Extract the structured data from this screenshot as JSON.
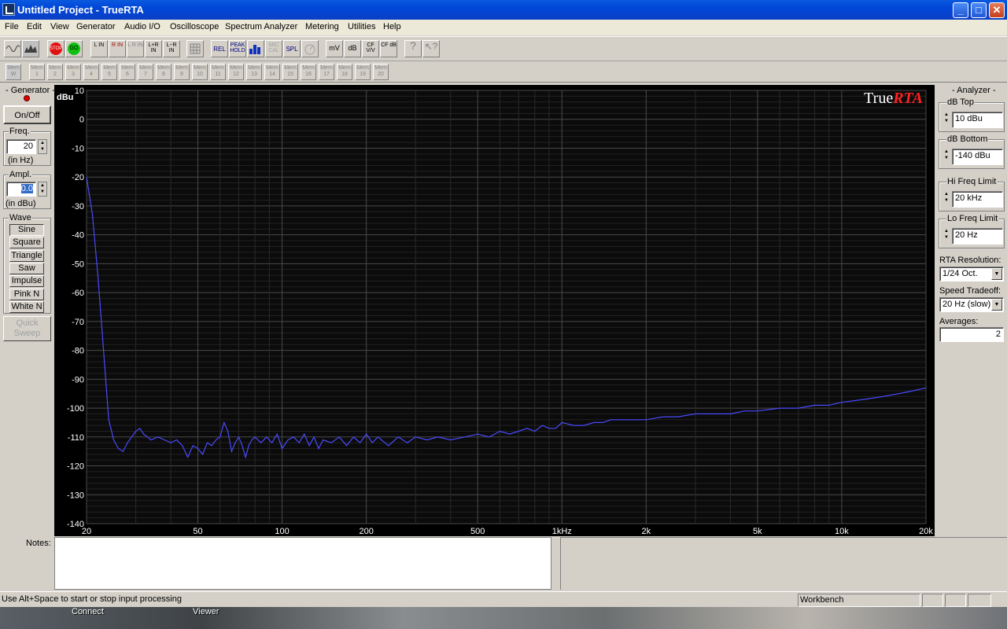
{
  "window": {
    "title": "Untitled Project - TrueRTA"
  },
  "menu": [
    "File",
    "Edit",
    "View",
    "Generator",
    "Audio I/O",
    "Oscilloscope",
    "Spectrum Analyzer",
    "Metering",
    "Utilities",
    "Help"
  ],
  "toolbar": {
    "stop": "STOP",
    "go": "GO",
    "l_in": "L IN",
    "r_in": "R IN",
    "lr_in": "L R IN",
    "lplusr_in": "L+R IN",
    "lminusr_in": "L−R IN",
    "rel": "REL",
    "peak_hold": "PEAK HOLD",
    "mic_cal": "MIC CAL",
    "spl": "SPL",
    "mv": "mV",
    "db": "dB",
    "cf_vv": "CF V/V",
    "cf_db": "CF dB"
  },
  "memory": {
    "write_label": "Mem W",
    "slot_label": "Mem",
    "slots": [
      "1",
      "2",
      "3",
      "4",
      "5",
      "6",
      "7",
      "8",
      "9",
      "10",
      "11",
      "12",
      "13",
      "14",
      "15",
      "16",
      "17",
      "18",
      "19",
      "20"
    ]
  },
  "generator": {
    "title": "- Generator -",
    "onoff": "On/Off",
    "freq_title": "Freq.",
    "freq_value": "20",
    "freq_unit": "(in Hz)",
    "ampl_title": "Ampl.",
    "ampl_value": "0.0",
    "ampl_unit": "(in dBu)",
    "wave_title": "Wave",
    "waves": [
      "Sine",
      "Square",
      "Triangle",
      "Saw",
      "Impulse",
      "Pink N",
      "White N"
    ],
    "quick_sweep": [
      "Quick",
      "Sweep"
    ]
  },
  "analyzer": {
    "title": "- Analyzer -",
    "db_top_label": "dB Top",
    "db_top_value": "10 dBu",
    "db_bottom_label": "dB Bottom",
    "db_bottom_value": "-140 dBu",
    "hi_freq_label": "Hi Freq Limit",
    "hi_freq_value": "20 kHz",
    "lo_freq_label": "Lo Freq Limit",
    "lo_freq_value": "20 Hz",
    "rta_res_label": "RTA Resolution:",
    "rta_res_value": "1/24 Oct.",
    "speed_label": "Speed Tradeoff:",
    "speed_value": "20 Hz (slow)",
    "averages_label": "Averages:",
    "averages_value": "2"
  },
  "chart_data": {
    "type": "line",
    "logo_true": "True",
    "logo_rta": "RTA",
    "ylabel": "dBu",
    "xscale": "log",
    "xlim": [
      20,
      20000
    ],
    "ylim": [
      -140,
      10
    ],
    "yticks": [
      10,
      0,
      -10,
      -20,
      -30,
      -40,
      -50,
      -60,
      -70,
      -80,
      -90,
      -100,
      -110,
      -120,
      -130,
      -140
    ],
    "xticks": [
      {
        "v": 20,
        "label": "20"
      },
      {
        "v": 50,
        "label": "50"
      },
      {
        "v": 100,
        "label": "100"
      },
      {
        "v": 200,
        "label": "200"
      },
      {
        "v": 500,
        "label": "500"
      },
      {
        "v": 1000,
        "label": "1kHz"
      },
      {
        "v": 2000,
        "label": "2k"
      },
      {
        "v": 5000,
        "label": "5k"
      },
      {
        "v": 10000,
        "label": "10k"
      },
      {
        "v": 20000,
        "label": "20k"
      }
    ],
    "line_color": "#4a4aff",
    "grid": true,
    "series": [
      {
        "points": [
          [
            20,
            -20
          ],
          [
            21,
            -33
          ],
          [
            22,
            -55
          ],
          [
            23,
            -80
          ],
          [
            24,
            -104
          ],
          [
            25,
            -111
          ],
          [
            26,
            -114
          ],
          [
            27,
            -115
          ],
          [
            28,
            -112
          ],
          [
            29,
            -110
          ],
          [
            30,
            -108
          ],
          [
            31,
            -107
          ],
          [
            32,
            -109
          ],
          [
            33,
            -110
          ],
          [
            34,
            -111
          ],
          [
            36,
            -110
          ],
          [
            38,
            -111
          ],
          [
            40,
            -112
          ],
          [
            42,
            -111
          ],
          [
            44,
            -113
          ],
          [
            46,
            -117
          ],
          [
            48,
            -113
          ],
          [
            50,
            -114
          ],
          [
            52,
            -116
          ],
          [
            54,
            -112
          ],
          [
            56,
            -113
          ],
          [
            58,
            -111
          ],
          [
            60,
            -110
          ],
          [
            62,
            -105
          ],
          [
            64,
            -108
          ],
          [
            66,
            -115
          ],
          [
            68,
            -112
          ],
          [
            70,
            -110
          ],
          [
            72,
            -113
          ],
          [
            74,
            -117
          ],
          [
            76,
            -113
          ],
          [
            78,
            -111
          ],
          [
            80,
            -110
          ],
          [
            84,
            -112
          ],
          [
            88,
            -110
          ],
          [
            92,
            -112
          ],
          [
            96,
            -109
          ],
          [
            100,
            -114
          ],
          [
            105,
            -111
          ],
          [
            110,
            -110
          ],
          [
            115,
            -112
          ],
          [
            120,
            -109
          ],
          [
            125,
            -113
          ],
          [
            130,
            -110
          ],
          [
            135,
            -114
          ],
          [
            140,
            -111
          ],
          [
            150,
            -112
          ],
          [
            160,
            -110
          ],
          [
            170,
            -113
          ],
          [
            180,
            -110
          ],
          [
            190,
            -112
          ],
          [
            200,
            -109
          ],
          [
            210,
            -112
          ],
          [
            220,
            -110
          ],
          [
            240,
            -113
          ],
          [
            260,
            -110
          ],
          [
            280,
            -112
          ],
          [
            300,
            -110
          ],
          [
            330,
            -111
          ],
          [
            360,
            -110
          ],
          [
            400,
            -111
          ],
          [
            450,
            -110
          ],
          [
            500,
            -109
          ],
          [
            550,
            -110
          ],
          [
            600,
            -108
          ],
          [
            650,
            -109
          ],
          [
            700,
            -108
          ],
          [
            750,
            -107
          ],
          [
            800,
            -108
          ],
          [
            850,
            -106
          ],
          [
            900,
            -107
          ],
          [
            950,
            -107
          ],
          [
            1000,
            -105
          ],
          [
            1100,
            -106
          ],
          [
            1200,
            -106
          ],
          [
            1300,
            -105
          ],
          [
            1400,
            -105
          ],
          [
            1500,
            -104
          ],
          [
            1700,
            -104
          ],
          [
            2000,
            -104
          ],
          [
            2300,
            -103
          ],
          [
            2600,
            -103
          ],
          [
            3000,
            -102
          ],
          [
            3500,
            -102
          ],
          [
            4000,
            -102
          ],
          [
            4500,
            -101
          ],
          [
            5000,
            -101
          ],
          [
            6000,
            -100
          ],
          [
            7000,
            -100
          ],
          [
            8000,
            -99
          ],
          [
            9000,
            -99
          ],
          [
            10000,
            -98
          ],
          [
            12000,
            -97
          ],
          [
            14000,
            -96
          ],
          [
            16000,
            -95
          ],
          [
            18000,
            -94
          ],
          [
            20000,
            -93
          ]
        ]
      }
    ]
  },
  "notes": {
    "label": "Notes:"
  },
  "status": {
    "hint": "Use Alt+Space to start or stop input processing",
    "mode": "Workbench"
  },
  "taskbar": {
    "connect": "Connect",
    "viewer": "Viewer"
  }
}
